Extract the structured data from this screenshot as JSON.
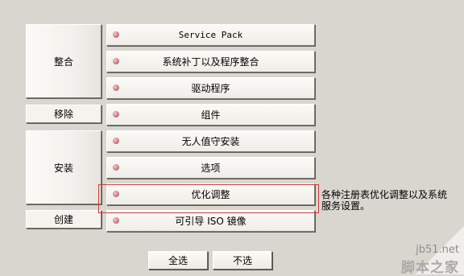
{
  "groups": {
    "integrate": "整合",
    "remove": "移除",
    "install": "安装",
    "create": "创建"
  },
  "items": {
    "service_pack": "Service Pack",
    "patches": "系统补丁以及程序整合",
    "drivers": "驱动程序",
    "components": "组件",
    "unattended": "无人值守安装",
    "options": "选项",
    "tweaks": "优化调整",
    "bootable_iso": "可引导 ISO 镜像"
  },
  "tooltip": "各种注册表优化调整以及系统服务设置。",
  "buttons": {
    "select_all": "全选",
    "select_none": "不选"
  },
  "watermark": {
    "url": "jb51.net",
    "name": "脚本之家"
  },
  "colors": {
    "background": "#d9d6cf",
    "highlight_border": "#d03a3a",
    "indicator": "#c77b7b"
  }
}
